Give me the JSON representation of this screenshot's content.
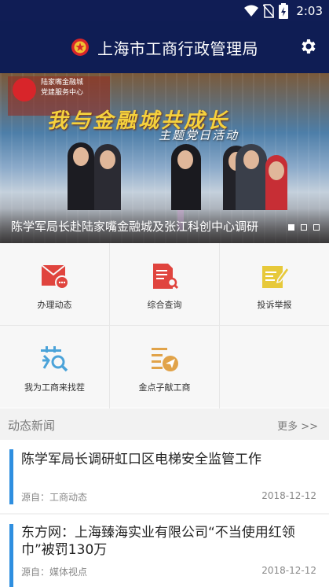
{
  "status_bar": {
    "time": "2:03"
  },
  "app_bar": {
    "title": "上海市工商行政管理局"
  },
  "banner": {
    "party_text_line1": "陆家嘴金融城",
    "party_text_line2": "党建服务中心",
    "slogan": "我与金融城共成长",
    "slogan_sub": "主题党日活动",
    "caption": "陈学军局长赴陆家嘴金融城及张江科创中心调研"
  },
  "functions": [
    {
      "label": "办理动态",
      "icon": "mail-chat-icon",
      "color": "#e0443e"
    },
    {
      "label": "综合查询",
      "icon": "document-search-icon",
      "color": "#e0443e"
    },
    {
      "label": "投诉举报",
      "icon": "edit-document-icon",
      "color": "#e7c93a"
    },
    {
      "label": "我为工商来找茬",
      "icon": "magnifier-tree-icon",
      "color": "#4ba3d9"
    },
    {
      "label": "金点子献工商",
      "icon": "send-list-icon",
      "color": "#e1a349"
    }
  ],
  "news_section": {
    "title": "动态新闻",
    "more": "更多 >>"
  },
  "news": [
    {
      "title": "陈学军局长调研虹口区电梯安全监管工作",
      "source": "源自：工商动态",
      "date": "2018-12-12"
    },
    {
      "title": "东方网：上海臻海实业有限公司“不当使用红领巾”被罚130万",
      "source": "源自：媒体视点",
      "date": "2018-12-12"
    }
  ]
}
